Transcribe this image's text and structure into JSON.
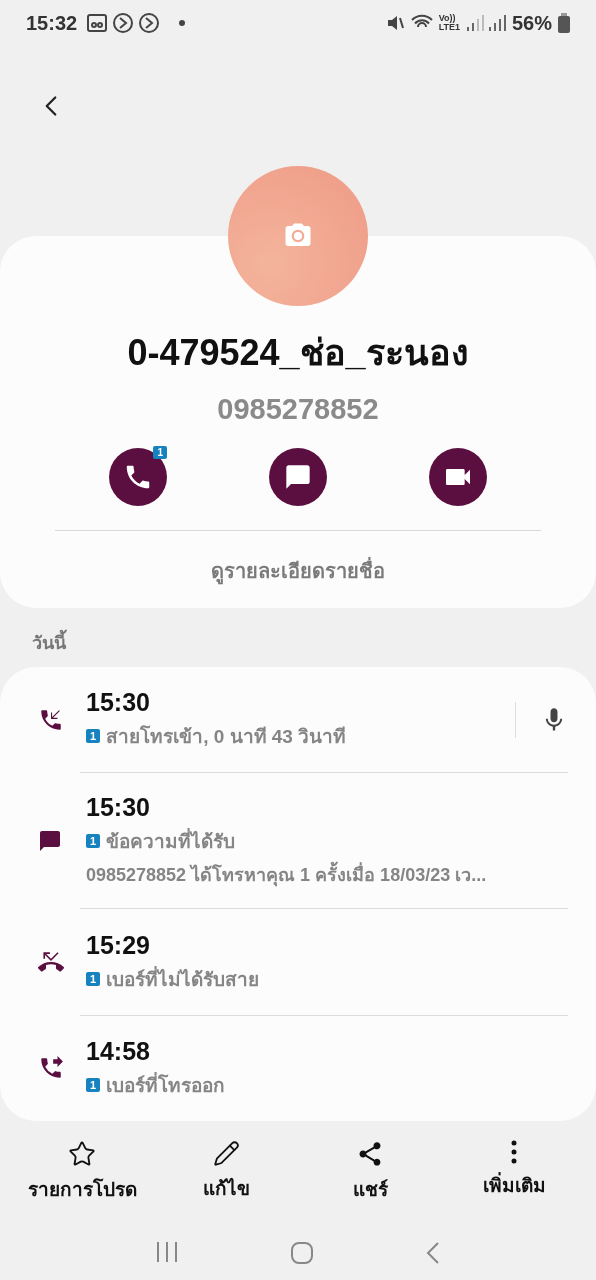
{
  "status_bar": {
    "time": "15:32",
    "volte": "Vo))",
    "lte": "LTE1",
    "battery": "56%"
  },
  "contact": {
    "name": "0-479524_ช่อ_ระนอง",
    "number": "0985278852",
    "call_badge": "1",
    "details_link": "ดูรายละเอียดรายชื่อ"
  },
  "section_title": "วันนี้",
  "log": [
    {
      "kind": "incoming",
      "time": "15:30",
      "sim": "1",
      "text": "สายโทรเข้า, 0 นาที 43 วินาที",
      "has_recording": true
    },
    {
      "kind": "message",
      "time": "15:30",
      "sim": "1",
      "text": "ข้อความที่ได้รับ",
      "detail": "0985278852 ได้โทรหาคุณ 1 ครั้งเมื่อ 18/03/23 เว...",
      "has_recording": false
    },
    {
      "kind": "missed",
      "time": "15:29",
      "sim": "1",
      "text": "เบอร์ที่ไม่ได้รับสาย",
      "has_recording": false
    },
    {
      "kind": "outgoing",
      "time": "14:58",
      "sim": "1",
      "text": "เบอร์ที่โทรออก",
      "has_recording": false
    }
  ],
  "bottom_actions": [
    {
      "kind": "favorite",
      "label": "รายการโปรด"
    },
    {
      "kind": "edit",
      "label": "แก้ไข"
    },
    {
      "kind": "share",
      "label": "แชร์"
    },
    {
      "kind": "more",
      "label": "เพิ่มเติม"
    }
  ]
}
